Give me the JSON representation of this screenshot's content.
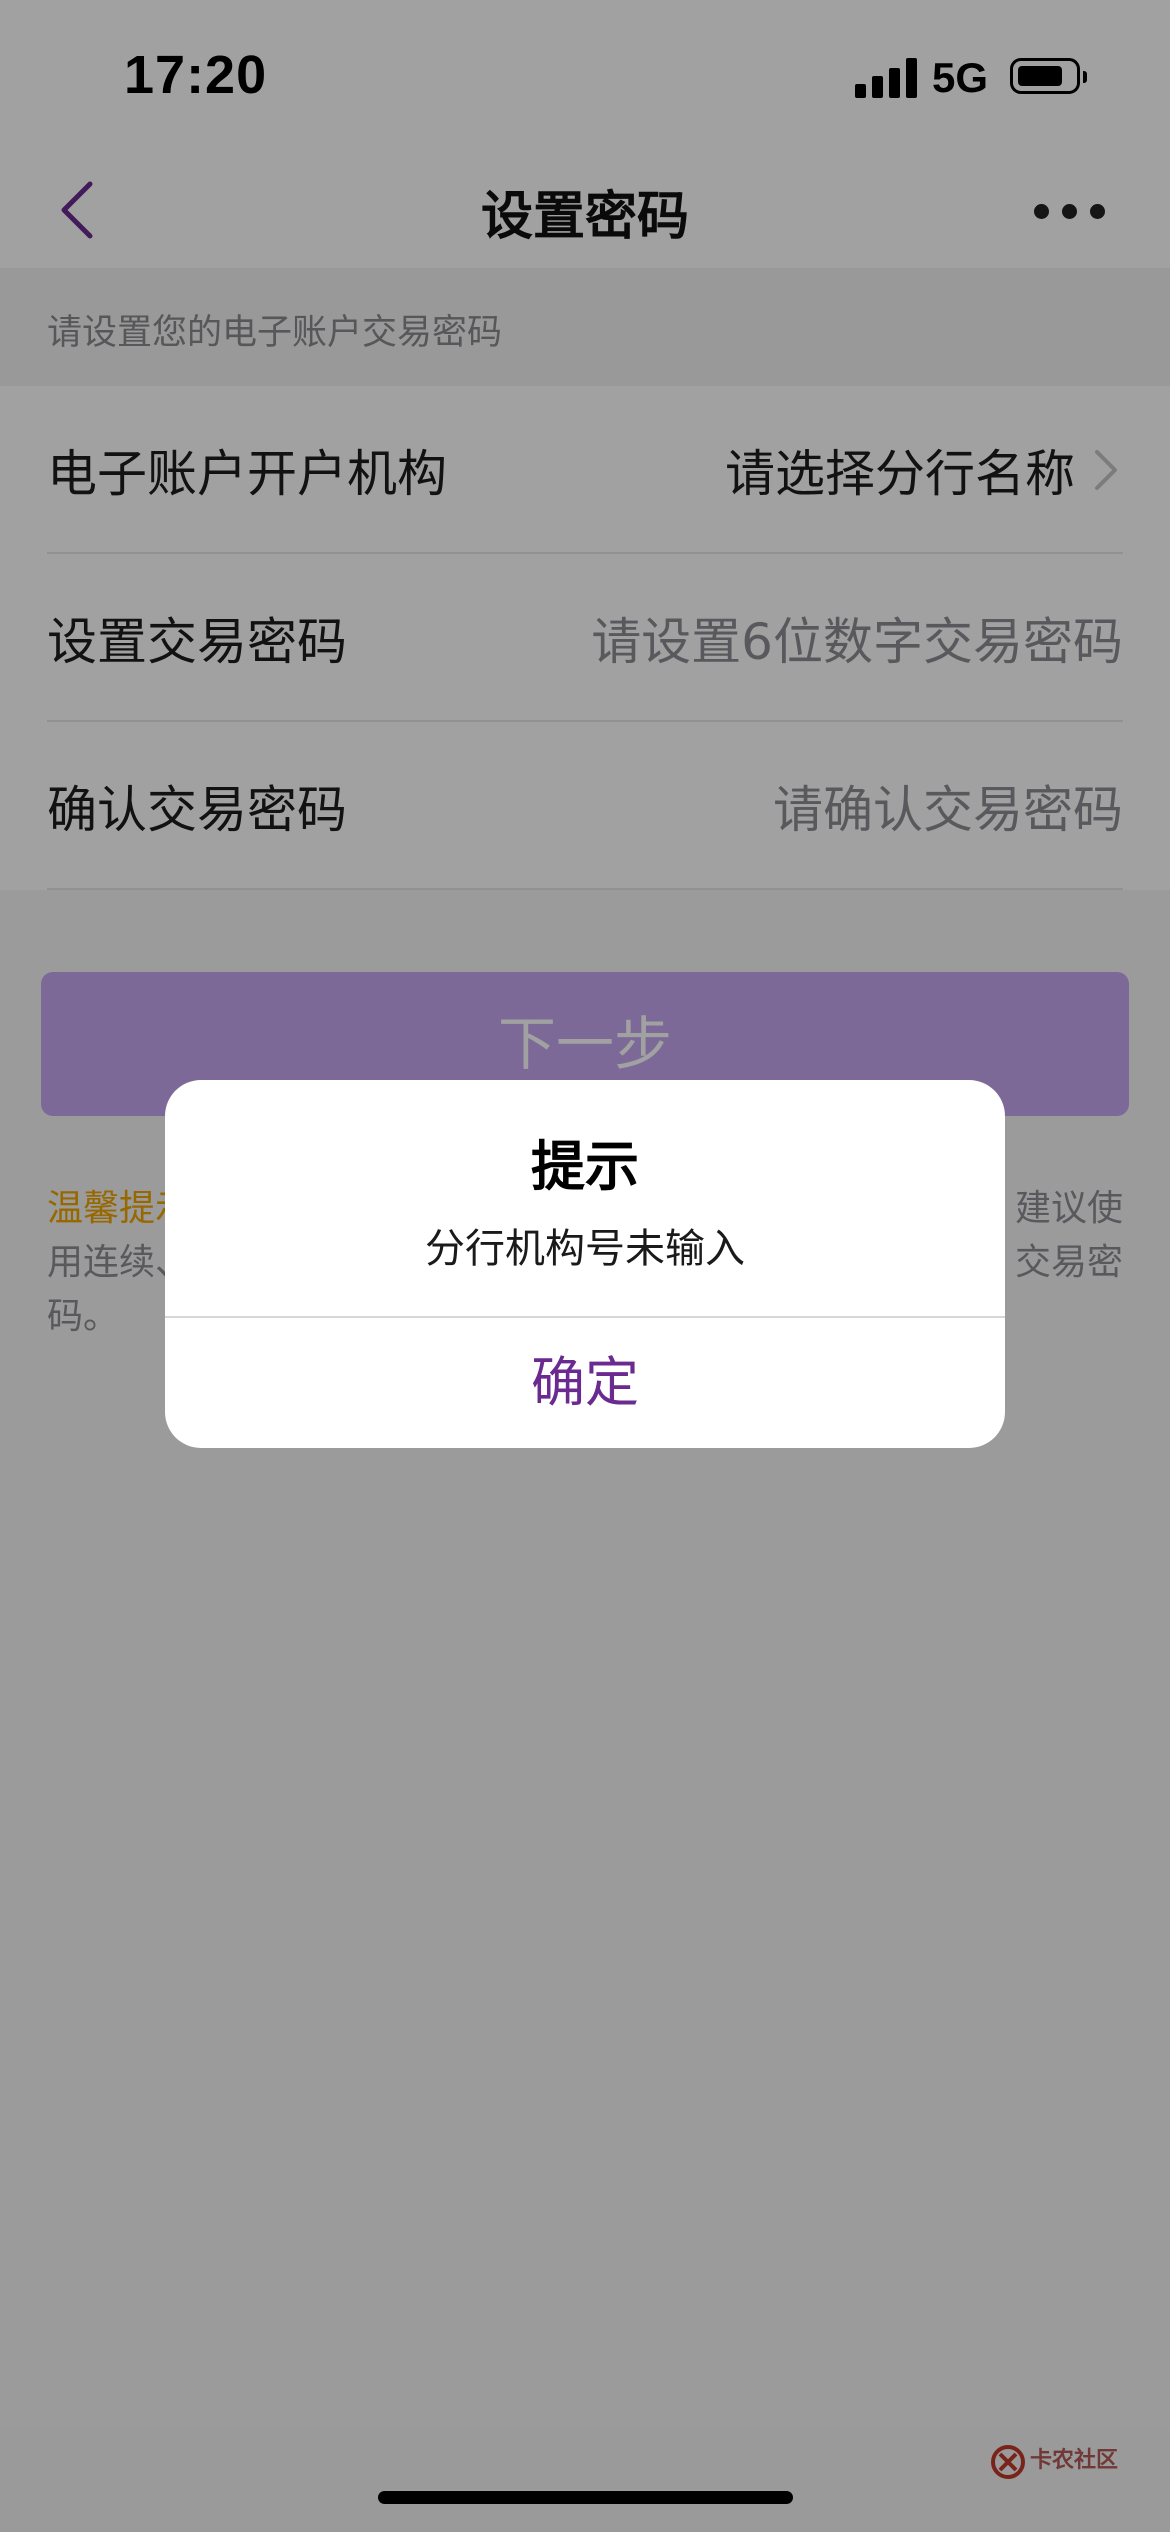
{
  "status_bar": {
    "time": "17:20",
    "network": "5G",
    "battery_level": 0.75
  },
  "nav": {
    "title": "设置密码",
    "back_icon": "chevron-left-icon",
    "more_icon": "more-horizontal-icon"
  },
  "subtitle": "请设置您的电子账户交易密码",
  "form": {
    "rows": [
      {
        "label": "电子账户开户机构",
        "value": "请选择分行名称"
      },
      {
        "label": "设置交易密码",
        "value": "请设置6位数字交易密码"
      },
      {
        "label": "确认交易密码",
        "value": "请确认交易密码"
      }
    ]
  },
  "next_button": "下一步",
  "tip": {
    "label": "温馨提示",
    "text_line1_end": "建议使",
    "text_line2_start": "用连续、",
    "text_line2_end": "交易密",
    "text_line3": "码。"
  },
  "alert": {
    "title": "提示",
    "message": "分行机构号未输入",
    "confirm": "确定"
  },
  "colors": {
    "accent": "#6a2a8f",
    "button_disabled": "#c6a7f1",
    "tip_label": "#f0a500"
  },
  "watermark": {
    "text": "卡农社区"
  }
}
